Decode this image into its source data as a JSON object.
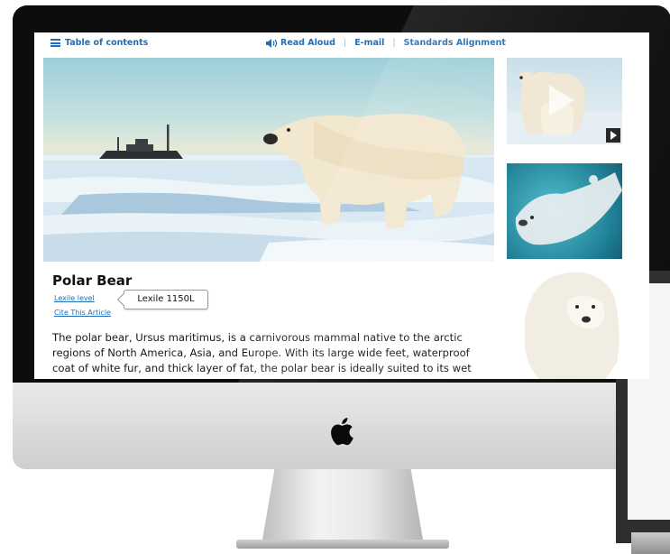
{
  "topbar": {
    "toc_label": "Table of contents",
    "read_aloud_label": "Read Aloud",
    "email_label": "E-mail",
    "standards_label": "Standards Alignment",
    "separator": "|"
  },
  "article": {
    "title": "Polar Bear",
    "lexile_link": "Lexile level",
    "lexile_value": "Lexile 1150L",
    "cite_link": "Cite This Article",
    "body": "The polar bear, Ursus maritimus, is a carnivorous mammal native to the arctic regions of North America, Asia, and Europe. With its large wide feet, waterproof coat of white fur, and thick layer of fat, the polar bear is ideally suited to its wet"
  },
  "colors": {
    "link_blue": "#1e6fb8"
  },
  "icons": {
    "menu": "hamburger-icon",
    "audio": "speaker-icon",
    "device_logo": "apple-logo",
    "video": "play-icon"
  }
}
